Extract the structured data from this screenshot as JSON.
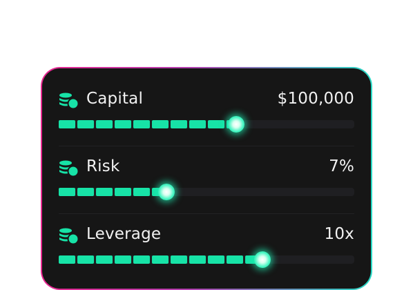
{
  "sliders": [
    {
      "label": "Capital",
      "value": "$100,000",
      "fraction": 0.6,
      "icon": "coins-icon"
    },
    {
      "label": "Risk",
      "value": "7%",
      "fraction": 0.365,
      "icon": "coins-icon"
    },
    {
      "label": "Leverage",
      "value": "10x",
      "fraction": 0.69,
      "icon": "coins-icon"
    }
  ],
  "colors": {
    "accent": "#17e3a7",
    "card": "#161616",
    "border_start": "#e8268f",
    "border_end": "#26d9c4"
  }
}
